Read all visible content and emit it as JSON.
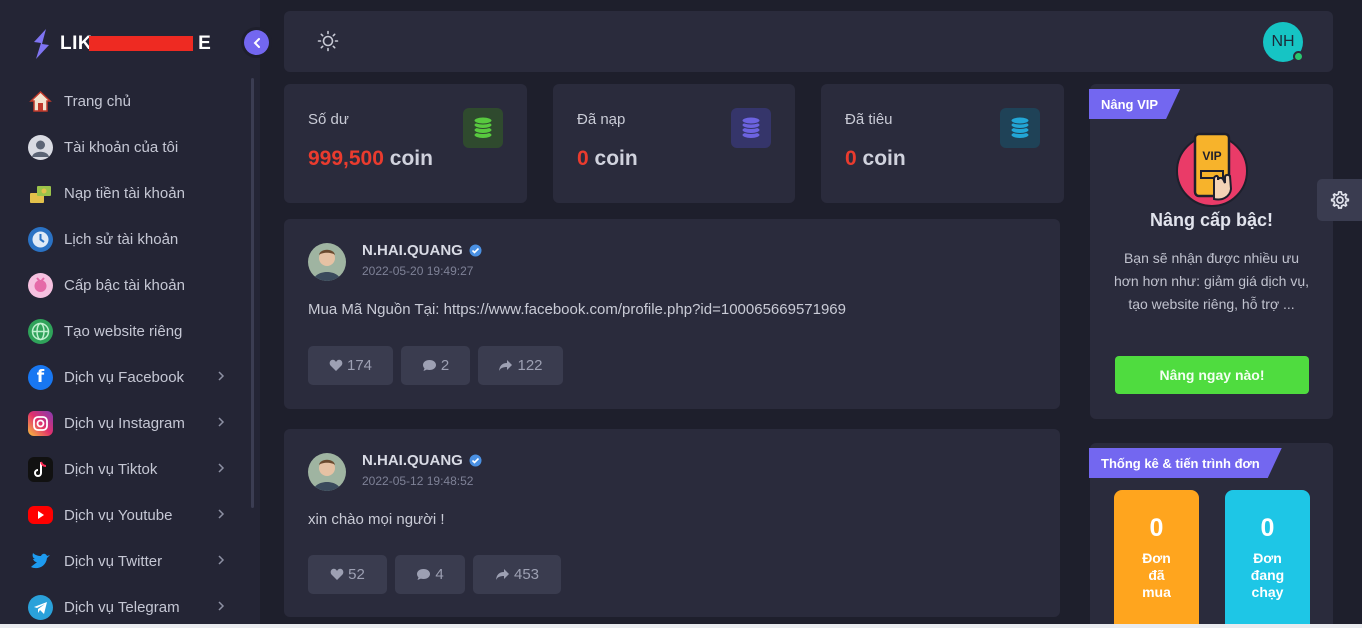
{
  "brand": {
    "name_prefix": "LIK",
    "name_suffix": "E"
  },
  "sidebar": {
    "items": [
      {
        "label": "Trang chủ",
        "icon": "home-icon",
        "has_submenu": false
      },
      {
        "label": "Tài khoản của tôi",
        "icon": "user-icon",
        "has_submenu": false
      },
      {
        "label": "Nạp tiền tài khoản",
        "icon": "money-icon",
        "has_submenu": false
      },
      {
        "label": "Lịch sử tài khoản",
        "icon": "clock-icon",
        "has_submenu": false
      },
      {
        "label": "Cấp bậc tài khoản",
        "icon": "rank-icon",
        "has_submenu": false
      },
      {
        "label": "Tạo website riêng",
        "icon": "globe-icon",
        "has_submenu": false
      },
      {
        "label": "Dịch vụ Facebook",
        "icon": "facebook-icon",
        "has_submenu": true
      },
      {
        "label": "Dịch vụ Instagram",
        "icon": "instagram-icon",
        "has_submenu": true
      },
      {
        "label": "Dịch vụ Tiktok",
        "icon": "tiktok-icon",
        "has_submenu": true
      },
      {
        "label": "Dịch vụ Youtube",
        "icon": "youtube-icon",
        "has_submenu": true
      },
      {
        "label": "Dịch vụ Twitter",
        "icon": "twitter-icon",
        "has_submenu": true
      },
      {
        "label": "Dịch vụ Telegram",
        "icon": "telegram-icon",
        "has_submenu": true
      }
    ]
  },
  "topbar": {
    "avatar_initials": "NH"
  },
  "stats": [
    {
      "label": "Số dư",
      "amount": "999,500",
      "unit": "coin",
      "color": "#3fbf3a"
    },
    {
      "label": "Đã nạp",
      "amount": "0",
      "unit": "coin",
      "color": "#6c63e0"
    },
    {
      "label": "Đã tiêu",
      "amount": "0",
      "unit": "coin",
      "color": "#22a6d6"
    }
  ],
  "posts": [
    {
      "author": "N.HAI.QUANG",
      "time": "2022-05-20 19:49:27",
      "content": "Mua Mã Nguồn Tại: https://www.facebook.com/profile.php?id=100065669571969",
      "likes": "174",
      "comments": "2",
      "shares": "122"
    },
    {
      "author": "N.HAI.QUANG",
      "time": "2022-05-12 19:48:52",
      "content": "xin chào mọi người !",
      "likes": "52",
      "comments": "4",
      "shares": "453"
    }
  ],
  "vip": {
    "ribbon": "Nâng VIP",
    "badge_text": "VIP",
    "title": "Nâng cấp bậc!",
    "description": "Bạn sẽ nhận được nhiều ưu hơn hơn như: giảm giá dịch vụ, tạo website riêng, hỗ trợ ...",
    "button": "Nâng ngay nào!"
  },
  "orders": {
    "ribbon": "Thống kê & tiến trình đơn",
    "tiles": [
      {
        "value": "0",
        "label_lines": [
          "Đơn",
          "đã",
          "mua"
        ],
        "color": "#ffa51e"
      },
      {
        "value": "0",
        "label_lines": [
          "Đơn",
          "đang",
          "chạy"
        ],
        "color": "#1ec6e6"
      }
    ]
  },
  "colors": {
    "accent": "#7367f0",
    "danger": "#ea3b2e",
    "success": "#4fdc3f"
  }
}
